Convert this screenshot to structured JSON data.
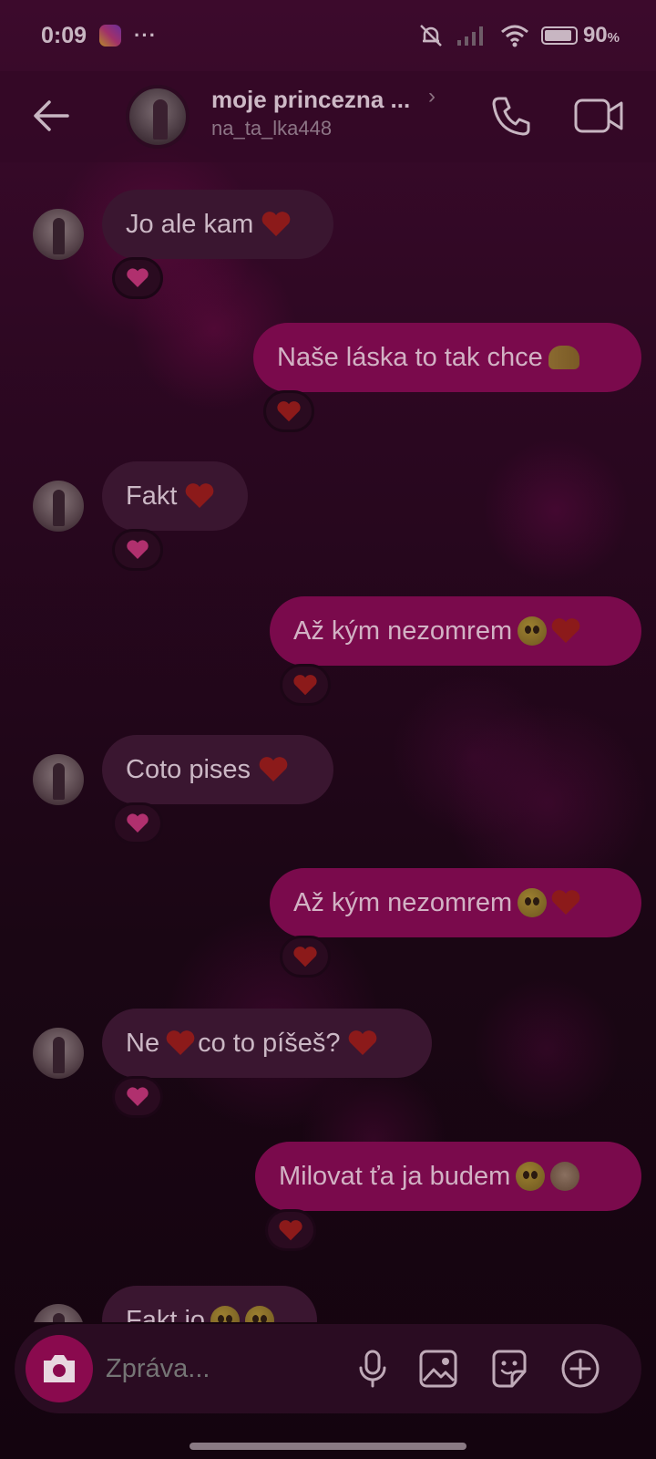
{
  "status_bar": {
    "time": "0:09",
    "dots": "···",
    "battery": "90",
    "battery_unit": "%",
    "battery_level": 0.9
  },
  "header": {
    "name": "moje princezna ...",
    "username": "na_ta_lka448",
    "chevron": "›"
  },
  "messages": [
    {
      "side": "in",
      "text": "Jo ale kam",
      "emoji": [
        "red-heart"
      ],
      "reaction": "pink-heart"
    },
    {
      "side": "out",
      "text": "Naše láska to tak chce",
      "emoji": [
        "heart-hands"
      ],
      "reaction": "red-heart"
    },
    {
      "side": "in",
      "text": "Fakt",
      "emoji": [
        "red-heart"
      ],
      "reaction": "pink-heart"
    },
    {
      "side": "out",
      "text": "Až kým nezomrem",
      "emoji": [
        "pleading-face",
        "red-heart"
      ],
      "reaction": "red-heart"
    },
    {
      "side": "in",
      "text": "Coto pises",
      "emoji": [
        "red-heart"
      ],
      "reaction": "pink-heart"
    },
    {
      "side": "out",
      "text": "Až kým nezomrem",
      "emoji": [
        "pleading-face",
        "red-heart"
      ],
      "reaction": "red-heart"
    },
    {
      "side": "in",
      "text": "Ne",
      "text2": "co to píšeš?",
      "emoji": [
        "red-heart",
        "red-heart"
      ],
      "reaction": "pink-heart"
    },
    {
      "side": "out",
      "text": "Milovat ťa ja budem",
      "emoji": [
        "heart-eyes-cat",
        "see-no-evil-monkey"
      ],
      "reaction": "red-heart"
    },
    {
      "side": "in",
      "text": "Fakt jo",
      "emoji": [
        "heart-eyes-cat",
        "face"
      ],
      "reaction": ""
    }
  ],
  "composer": {
    "placeholder": "Zpráva..."
  },
  "icons": {
    "back": "arrow-left-icon",
    "call": "phone-icon",
    "video": "video-camera-icon",
    "camera": "camera-icon",
    "mic": "microphone-icon",
    "gallery": "image-icon",
    "sticker": "sticker-icon",
    "plus": "plus-circle-icon"
  },
  "colors": {
    "outgoing_bubble": "#7a0a4c",
    "incoming_bubble": "#3a1630",
    "camera_button": "#8a0a4e",
    "heart_red": "#8c1a1a",
    "heart_pink": "#b0306e"
  }
}
